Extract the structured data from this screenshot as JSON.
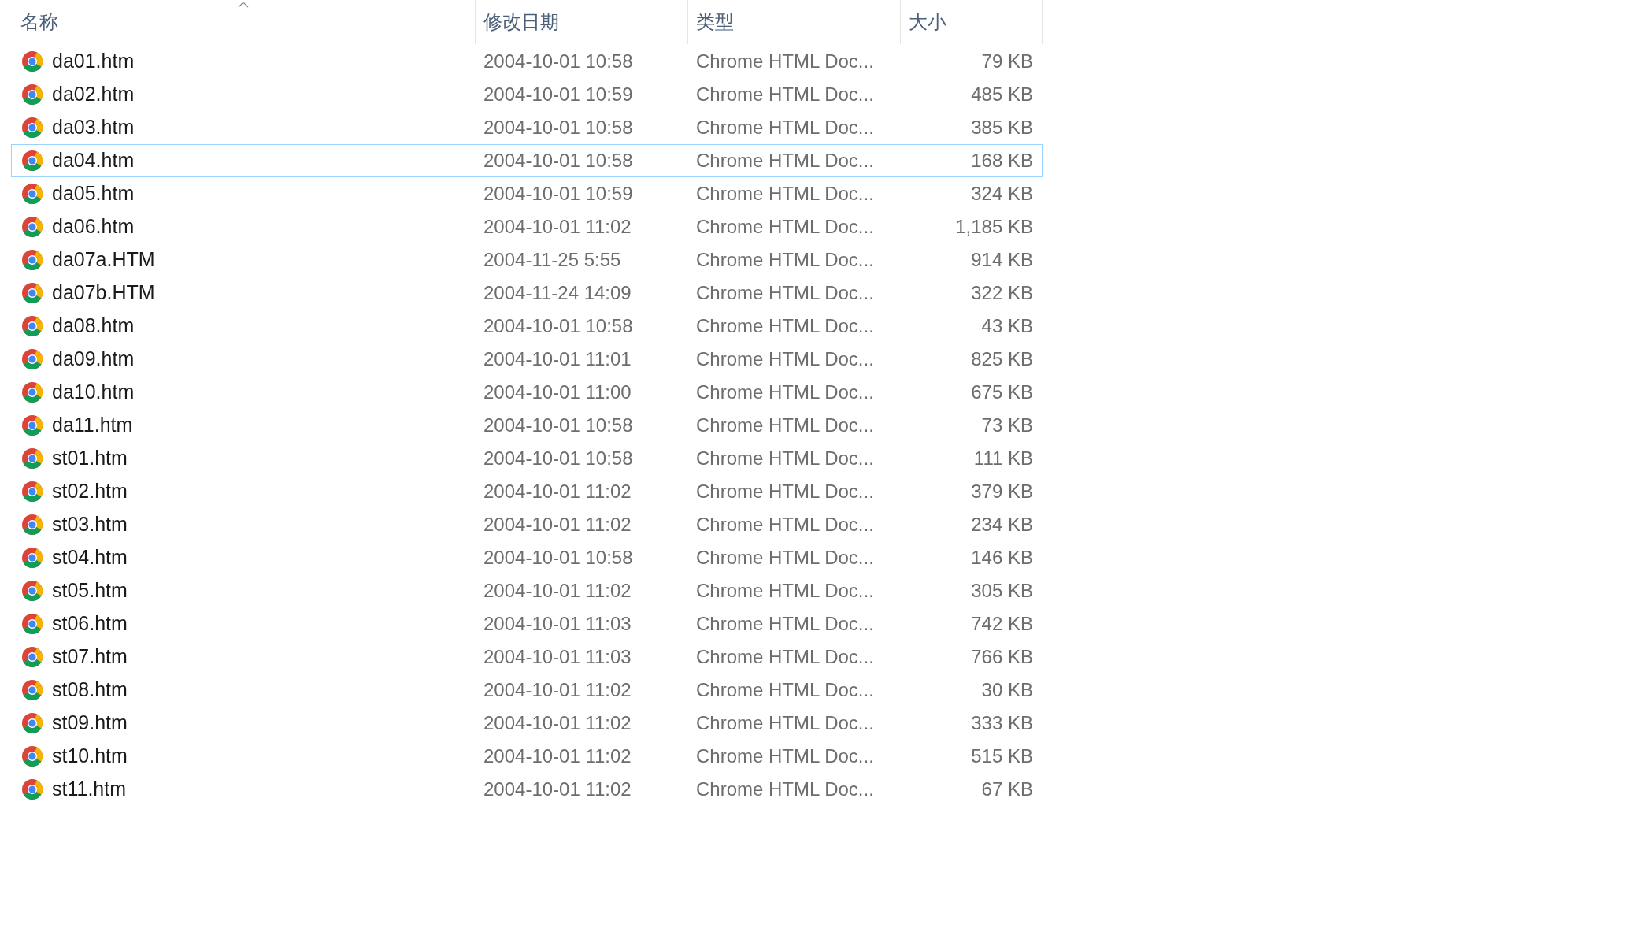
{
  "columns": [
    {
      "label": "名称",
      "sorted": true
    },
    {
      "label": "修改日期",
      "sorted": false
    },
    {
      "label": "类型",
      "sorted": false
    },
    {
      "label": "大小",
      "sorted": false
    }
  ],
  "files": [
    {
      "name": "da01.htm",
      "modified": "2004-10-01 10:58",
      "type": "Chrome HTML Doc...",
      "size": "79 KB",
      "focused": false
    },
    {
      "name": "da02.htm",
      "modified": "2004-10-01 10:59",
      "type": "Chrome HTML Doc...",
      "size": "485 KB",
      "focused": false
    },
    {
      "name": "da03.htm",
      "modified": "2004-10-01 10:58",
      "type": "Chrome HTML Doc...",
      "size": "385 KB",
      "focused": false
    },
    {
      "name": "da04.htm",
      "modified": "2004-10-01 10:58",
      "type": "Chrome HTML Doc...",
      "size": "168 KB",
      "focused": true
    },
    {
      "name": "da05.htm",
      "modified": "2004-10-01 10:59",
      "type": "Chrome HTML Doc...",
      "size": "324 KB",
      "focused": false
    },
    {
      "name": "da06.htm",
      "modified": "2004-10-01 11:02",
      "type": "Chrome HTML Doc...",
      "size": "1,185 KB",
      "focused": false
    },
    {
      "name": "da07a.HTM",
      "modified": "2004-11-25 5:55",
      "type": "Chrome HTML Doc...",
      "size": "914 KB",
      "focused": false
    },
    {
      "name": "da07b.HTM",
      "modified": "2004-11-24 14:09",
      "type": "Chrome HTML Doc...",
      "size": "322 KB",
      "focused": false
    },
    {
      "name": "da08.htm",
      "modified": "2004-10-01 10:58",
      "type": "Chrome HTML Doc...",
      "size": "43 KB",
      "focused": false
    },
    {
      "name": "da09.htm",
      "modified": "2004-10-01 11:01",
      "type": "Chrome HTML Doc...",
      "size": "825 KB",
      "focused": false
    },
    {
      "name": "da10.htm",
      "modified": "2004-10-01 11:00",
      "type": "Chrome HTML Doc...",
      "size": "675 KB",
      "focused": false
    },
    {
      "name": "da11.htm",
      "modified": "2004-10-01 10:58",
      "type": "Chrome HTML Doc...",
      "size": "73 KB",
      "focused": false
    },
    {
      "name": "st01.htm",
      "modified": "2004-10-01 10:58",
      "type": "Chrome HTML Doc...",
      "size": "111 KB",
      "focused": false
    },
    {
      "name": "st02.htm",
      "modified": "2004-10-01 11:02",
      "type": "Chrome HTML Doc...",
      "size": "379 KB",
      "focused": false
    },
    {
      "name": "st03.htm",
      "modified": "2004-10-01 11:02",
      "type": "Chrome HTML Doc...",
      "size": "234 KB",
      "focused": false
    },
    {
      "name": "st04.htm",
      "modified": "2004-10-01 10:58",
      "type": "Chrome HTML Doc...",
      "size": "146 KB",
      "focused": false
    },
    {
      "name": "st05.htm",
      "modified": "2004-10-01 11:02",
      "type": "Chrome HTML Doc...",
      "size": "305 KB",
      "focused": false
    },
    {
      "name": "st06.htm",
      "modified": "2004-10-01 11:03",
      "type": "Chrome HTML Doc...",
      "size": "742 KB",
      "focused": false
    },
    {
      "name": "st07.htm",
      "modified": "2004-10-01 11:03",
      "type": "Chrome HTML Doc...",
      "size": "766 KB",
      "focused": false
    },
    {
      "name": "st08.htm",
      "modified": "2004-10-01 11:02",
      "type": "Chrome HTML Doc...",
      "size": "30 KB",
      "focused": false
    },
    {
      "name": "st09.htm",
      "modified": "2004-10-01 11:02",
      "type": "Chrome HTML Doc...",
      "size": "333 KB",
      "focused": false
    },
    {
      "name": "st10.htm",
      "modified": "2004-10-01 11:02",
      "type": "Chrome HTML Doc...",
      "size": "515 KB",
      "focused": false
    },
    {
      "name": "st11.htm",
      "modified": "2004-10-01 11:02",
      "type": "Chrome HTML Doc...",
      "size": "67 KB",
      "focused": false
    }
  ]
}
